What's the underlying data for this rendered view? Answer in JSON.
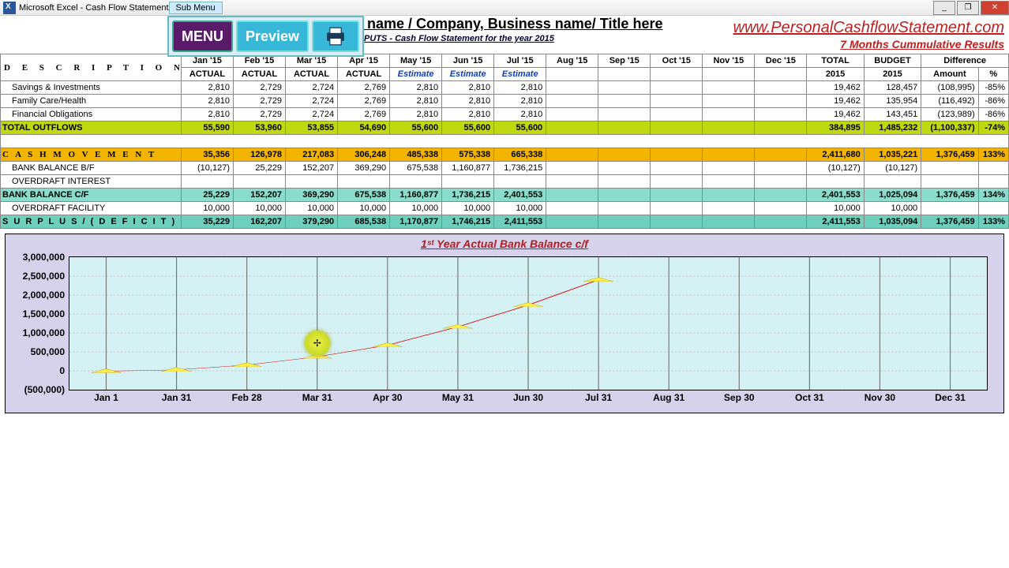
{
  "window": {
    "app_title": "Microsoft Excel - Cash Flow Statement",
    "submenu_label": "Sub Menu"
  },
  "toolbar": {
    "menu": "MENU",
    "preview": "Preview"
  },
  "header": {
    "title": "y name / Company, Business name/ Title  here",
    "subtitle": "INPUTS - Cash Flow Statement for the year 2015",
    "site": "www.PersonalCashflowStatement.com",
    "cumulative": "7 Months Cummulative Results"
  },
  "columns": {
    "desc": "D E S C R I P T I O N",
    "months": [
      {
        "top": "Jan '15",
        "bot": "ACTUAL"
      },
      {
        "top": "Feb '15",
        "bot": "ACTUAL"
      },
      {
        "top": "Mar '15",
        "bot": "ACTUAL"
      },
      {
        "top": "Apr '15",
        "bot": "ACTUAL"
      },
      {
        "top": "May '15",
        "bot": "Estimate"
      },
      {
        "top": "Jun '15",
        "bot": "Estimate"
      },
      {
        "top": "Jul '15",
        "bot": "Estimate"
      },
      {
        "top": "Aug '15",
        "bot": ""
      },
      {
        "top": "Sep '15",
        "bot": ""
      },
      {
        "top": "Oct '15",
        "bot": ""
      },
      {
        "top": "Nov '15",
        "bot": ""
      },
      {
        "top": "Dec '15",
        "bot": ""
      }
    ],
    "total_top": "TOTAL",
    "total_bot": "2015",
    "budget_top": "BUDGET",
    "budget_bot": "2015",
    "diff": "Difference",
    "diff_amt": "Amount",
    "diff_pct": "%"
  },
  "rows": [
    {
      "label": "Savings & Investments",
      "cls": "",
      "v": [
        "2,810",
        "2,729",
        "2,724",
        "2,769",
        "2,810",
        "2,810",
        "2,810",
        "",
        "",
        "",
        "",
        ""
      ],
      "total": "19,462",
      "budget": "128,457",
      "diff": "(108,995)",
      "pct": "-85%"
    },
    {
      "label": "Family Care/Health",
      "cls": "",
      "v": [
        "2,810",
        "2,729",
        "2,724",
        "2,769",
        "2,810",
        "2,810",
        "2,810",
        "",
        "",
        "",
        "",
        ""
      ],
      "total": "19,462",
      "budget": "135,954",
      "diff": "(116,492)",
      "pct": "-86%"
    },
    {
      "label": "Financial Obligations",
      "cls": "",
      "v": [
        "2,810",
        "2,729",
        "2,724",
        "2,769",
        "2,810",
        "2,810",
        "2,810",
        "",
        "",
        "",
        "",
        ""
      ],
      "total": "19,462",
      "budget": "143,451",
      "diff": "(123,989)",
      "pct": "-86%"
    },
    {
      "label": "TOTAL OUTFLOWS",
      "cls": "row-yellow",
      "lb": true,
      "v": [
        "55,590",
        "53,960",
        "53,855",
        "54,690",
        "55,600",
        "55,600",
        "55,600",
        "",
        "",
        "",
        "",
        ""
      ],
      "total": "384,895",
      "budget": "1,485,232",
      "diff": "(1,100,337)",
      "pct": "-74%"
    },
    {
      "label": "",
      "cls": "spacer",
      "blank": true
    },
    {
      "label": "C A S H   M O V E M E N T",
      "cls": "row-orange",
      "lb": true,
      "v": [
        "35,356",
        "126,978",
        "217,083",
        "306,248",
        "485,338",
        "575,338",
        "665,338",
        "",
        "",
        "",
        "",
        ""
      ],
      "total": "2,411,680",
      "budget": "1,035,221",
      "diff": "1,376,459",
      "pct": "133%"
    },
    {
      "label": "BANK BALANCE  B/F",
      "cls": "",
      "v": [
        "(10,127)",
        "25,229",
        "152,207",
        "369,290",
        "675,538",
        "1,160,877",
        "1,736,215",
        "",
        "",
        "",
        "",
        ""
      ],
      "total": "(10,127)",
      "budget": "(10,127)",
      "diff": "",
      "pct": ""
    },
    {
      "label": "OVERDRAFT INTEREST",
      "cls": "",
      "v": [
        "",
        "",
        "",
        "",
        "",
        "",
        "",
        "",
        "",
        "",
        "",
        ""
      ],
      "total": "",
      "budget": "",
      "diff": "",
      "pct": ""
    },
    {
      "label": "BANK BALANCE  C/F",
      "cls": "row-teal",
      "lb": true,
      "v": [
        "25,229",
        "152,207",
        "369,290",
        "675,538",
        "1,160,877",
        "1,736,215",
        "2,401,553",
        "",
        "",
        "",
        "",
        ""
      ],
      "total": "2,401,553",
      "budget": "1,025,094",
      "diff": "1,376,459",
      "pct": "134%"
    },
    {
      "label": "OVERDRAFT FACILITY",
      "cls": "",
      "v": [
        "10,000",
        "10,000",
        "10,000",
        "10,000",
        "10,000",
        "10,000",
        "10,000",
        "",
        "",
        "",
        "",
        ""
      ],
      "total": "10,000",
      "budget": "10,000",
      "diff": "",
      "pct": ""
    },
    {
      "label": "S U R P L U S  /  ( D E F I C I T )",
      "cls": "row-teal2",
      "lb": true,
      "v": [
        "35,229",
        "162,207",
        "379,290",
        "685,538",
        "1,170,877",
        "1,746,215",
        "2,411,553",
        "",
        "",
        "",
        "",
        ""
      ],
      "total": "2,411,553",
      "budget": "1,035,094",
      "diff": "1,376,459",
      "pct": "133%"
    }
  ],
  "chart_data": {
    "type": "line",
    "title": "1ˢᵗ Year Actual Bank Balance c/f",
    "xlabel": "",
    "ylabel": "",
    "ylim": [
      -500000,
      3000000
    ],
    "yticks": [
      "3,000,000",
      "2,500,000",
      "2,000,000",
      "1,500,000",
      "1,000,000",
      "500,000",
      "0",
      "(500,000)"
    ],
    "ytick_vals": [
      3000000,
      2500000,
      2000000,
      1500000,
      1000000,
      500000,
      0,
      -500000
    ],
    "categories": [
      "Jan 1",
      "Jan 31",
      "Feb 28",
      "Mar 31",
      "Apr 30",
      "May 31",
      "Jun 30",
      "Jul 31",
      "Aug 31",
      "Sep 30",
      "Oct 31",
      "Nov 30",
      "Dec 31"
    ],
    "series": [
      {
        "name": "Bank Balance c/f",
        "values": [
          -10127,
          25229,
          152207,
          369290,
          675538,
          1160877,
          1736215,
          2401553,
          null,
          null,
          null,
          null,
          null
        ]
      }
    ]
  },
  "cursor": {
    "x_pct": 27,
    "y_pct": 65
  }
}
